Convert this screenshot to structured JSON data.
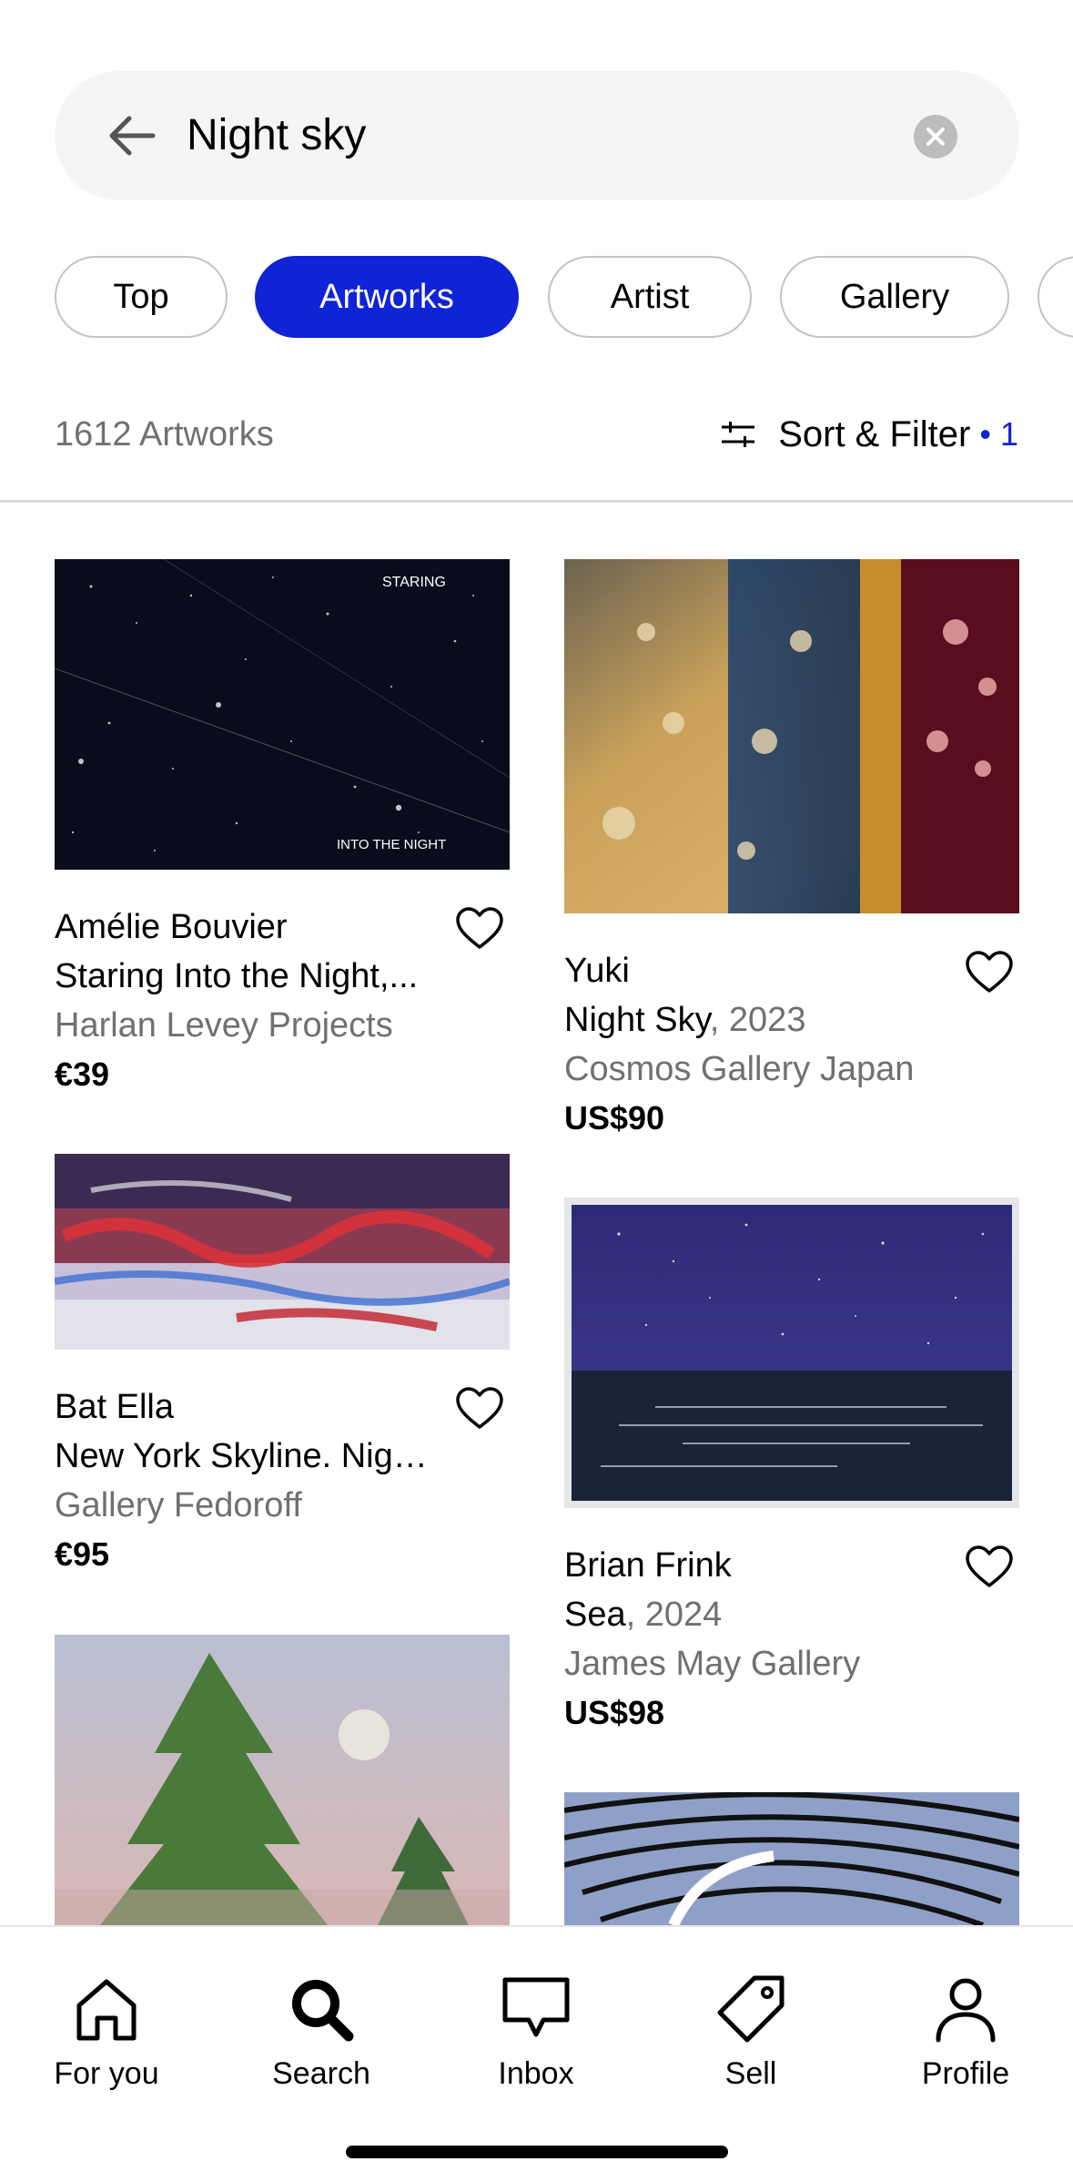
{
  "search": {
    "query": "Night sky"
  },
  "pills": [
    "Top",
    "Artworks",
    "Artist",
    "Gallery"
  ],
  "results": {
    "count_label": "1612 Artworks",
    "sort_label": "Sort & Filter",
    "filter_count": "• 1"
  },
  "artworks": [
    {
      "artist": "Amélie Bouvier",
      "title": "Staring Into the Night,...",
      "year": "",
      "gallery": "Harlan Levey Projects",
      "price": "€39",
      "image_text_top": "STARING",
      "image_text_bottom": "INTO THE NIGHT"
    },
    {
      "artist": "Yuki",
      "title": "Night Sky",
      "year": ", 2023",
      "gallery": "Cosmos Gallery Japan",
      "price": "US$90"
    },
    {
      "artist": "Bat Ella",
      "title": "New York Skyline. Nigh...",
      "year": "",
      "gallery": "Gallery Fedoroff",
      "price": "€95"
    },
    {
      "artist": "Brian Frink",
      "title": "Sea",
      "year": ", 2024",
      "gallery": "James May Gallery",
      "price": "US$98"
    }
  ],
  "tabs": [
    {
      "label": "For you",
      "icon": "home-icon"
    },
    {
      "label": "Search",
      "icon": "search-icon"
    },
    {
      "label": "Inbox",
      "icon": "inbox-icon"
    },
    {
      "label": "Sell",
      "icon": "tag-icon"
    },
    {
      "label": "Profile",
      "icon": "profile-icon"
    }
  ],
  "colors": {
    "accent": "#1023d7",
    "muted_text": "#707070"
  }
}
